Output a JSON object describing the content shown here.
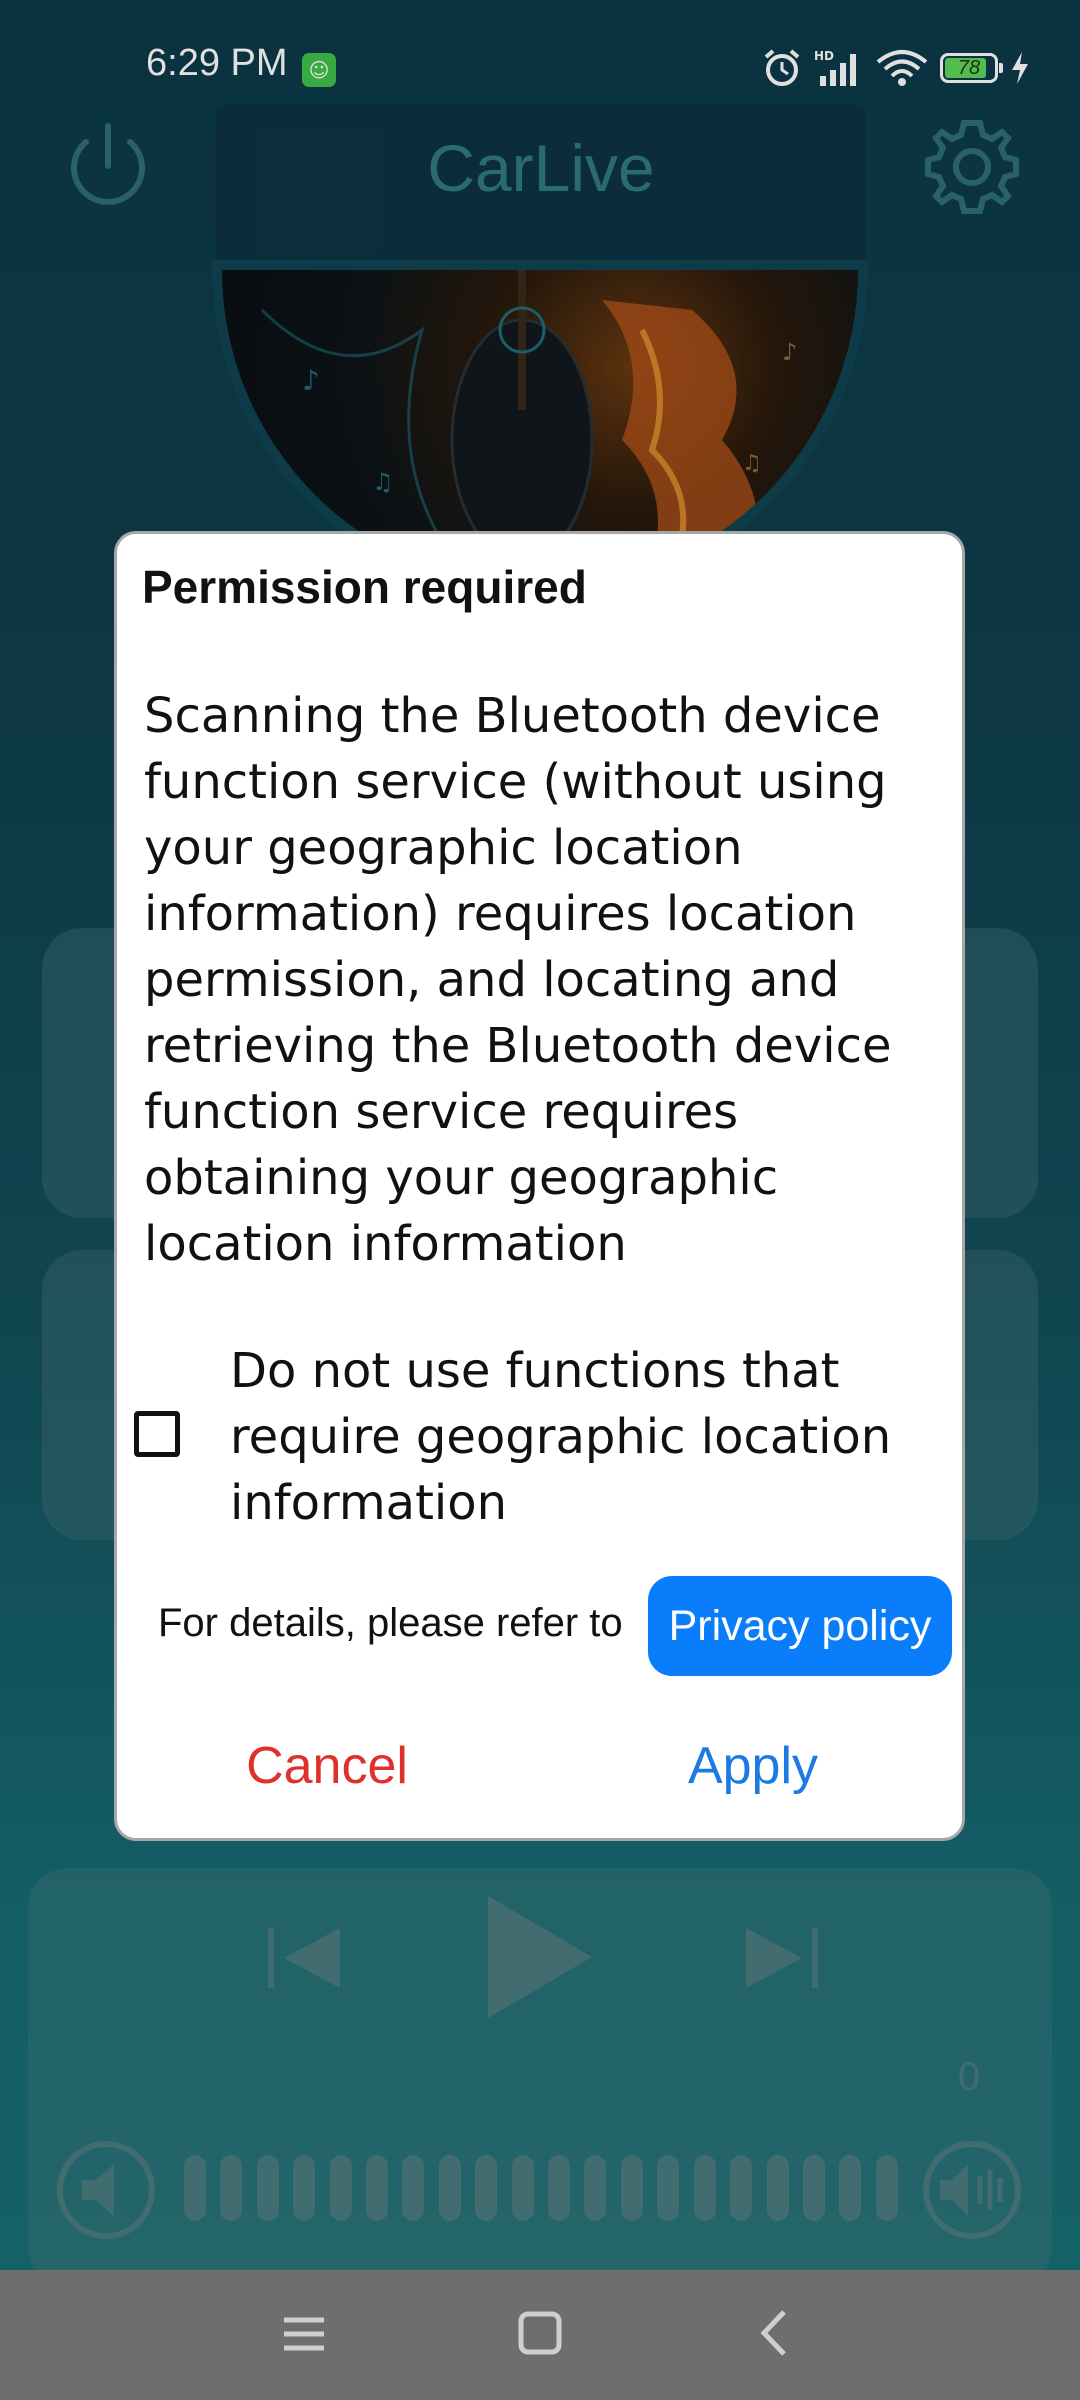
{
  "status_bar": {
    "time": "6:29 PM",
    "battery_level": "78",
    "icons": [
      "alarm-icon",
      "hd-signal-icon",
      "wifi-icon",
      "battery-icon",
      "charging-icon"
    ]
  },
  "app": {
    "title": "CarLive",
    "counter": "0"
  },
  "dialog": {
    "title": "Permission required",
    "message": "Scanning the Bluetooth device function service (without using your geographic location information) requires location permission, and locating and retrieving the Bluetooth device function service requires obtaining your geographic location information",
    "checkbox_label": "Do not use functions that require geographic location information",
    "checkbox_checked": false,
    "details_text": "For details, please refer to",
    "privacy_button": "Privacy policy",
    "cancel_button": "Cancel",
    "apply_button": "Apply"
  },
  "colors": {
    "accent_blue": "#0a7dfa",
    "cancel_red": "#e0302a",
    "apply_blue": "#1b7be3"
  }
}
